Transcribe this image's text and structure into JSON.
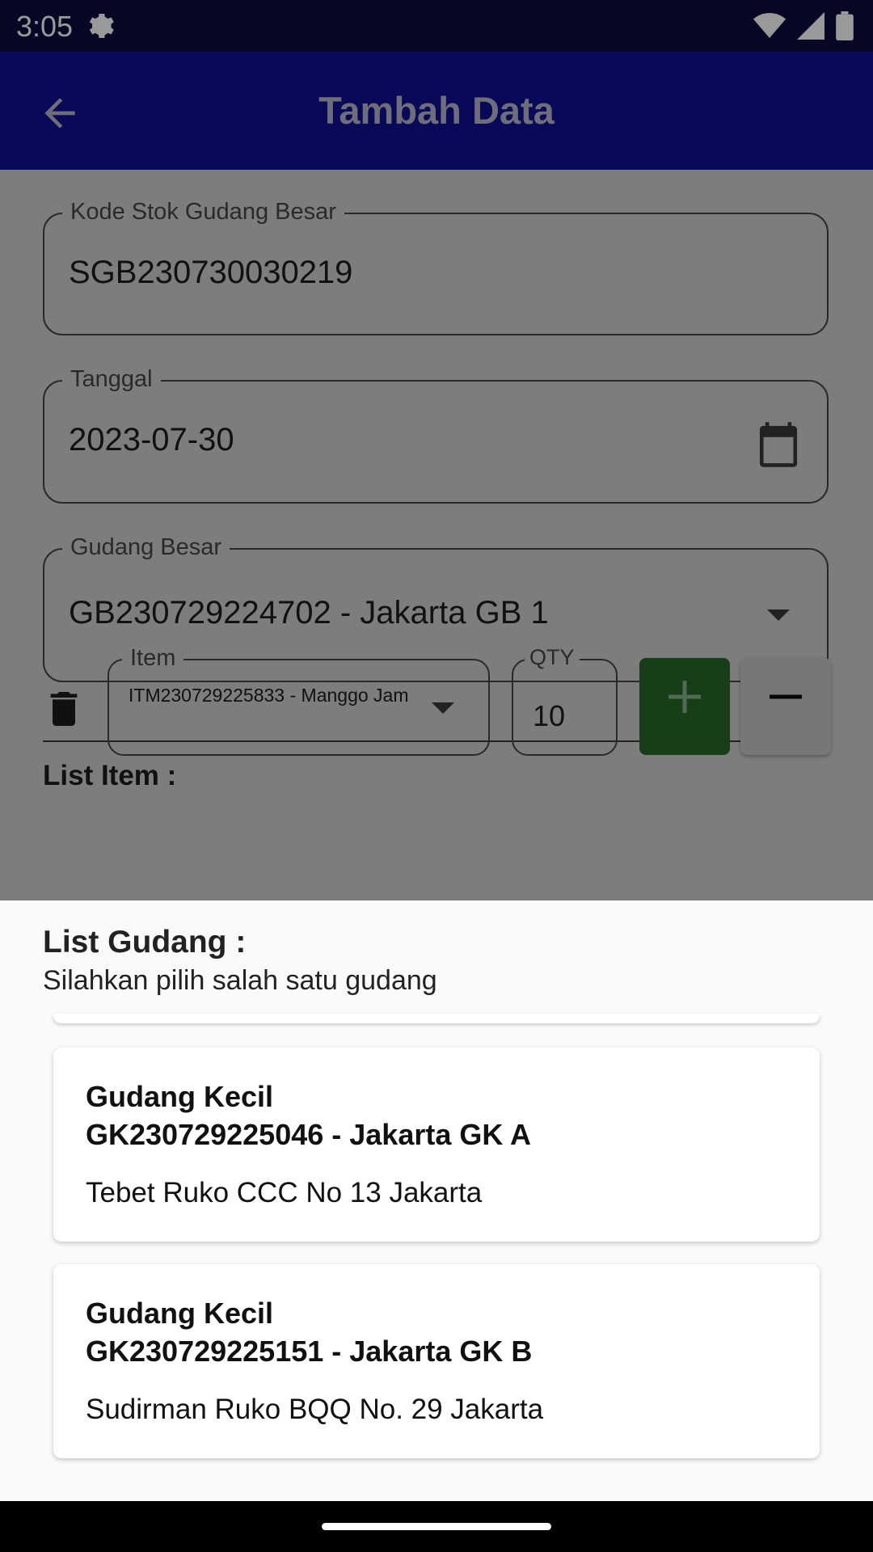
{
  "status_bar": {
    "time": "3:05"
  },
  "app_bar": {
    "title": "Tambah Data"
  },
  "form": {
    "kode_stok": {
      "label": "Kode Stok Gudang Besar",
      "value": "SGB230730030219"
    },
    "tanggal": {
      "label": "Tanggal",
      "value": "2023-07-30"
    },
    "gudang_besar": {
      "label": "Gudang Besar",
      "value": "GB230729224702 - Jakarta GB 1"
    },
    "list_item_title": "List Item :",
    "item": {
      "label": "Item",
      "value": "ITM230729225833 - Manggo Jam"
    },
    "qty": {
      "label": "QTY",
      "value": "10"
    }
  },
  "sheet": {
    "title": "List Gudang :",
    "subtitle": "Silahkan pilih salah satu gudang",
    "cards": [
      {
        "type": "Gudang Kecil",
        "code": "GK230729225046 - Jakarta GK A",
        "address": "Tebet Ruko CCC No 13 Jakarta"
      },
      {
        "type": "Gudang Kecil",
        "code": "GK230729225151 - Jakarta GK B",
        "address": "Sudirman Ruko BQQ No. 29 Jakarta"
      }
    ]
  },
  "colors": {
    "app_bar": "#0f0f96",
    "status_bar": "#0a0a3e",
    "add_button": "#2e7d32"
  }
}
